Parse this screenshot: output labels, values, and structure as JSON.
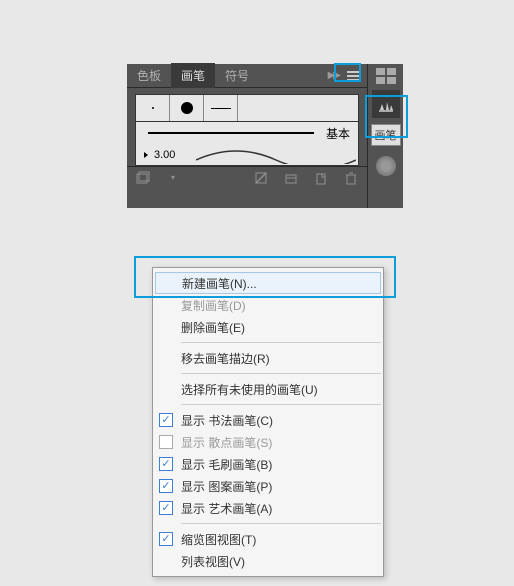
{
  "panel": {
    "tabs": [
      {
        "label": "色板",
        "active": false
      },
      {
        "label": "画笔",
        "active": true
      },
      {
        "label": "符号",
        "active": false
      }
    ],
    "basic_label": "基本",
    "stroke_value": "3.00",
    "side_label": "画笔"
  },
  "context_menu": {
    "items": [
      {
        "label": "新建画笔(N)...",
        "type": "normal",
        "highlighted": true
      },
      {
        "label": "复制画笔(D)",
        "type": "disabled"
      },
      {
        "label": "删除画笔(E)",
        "type": "normal"
      },
      {
        "type": "separator"
      },
      {
        "label": "移去画笔描边(R)",
        "type": "normal"
      },
      {
        "type": "separator"
      },
      {
        "label": "选择所有未使用的画笔(U)",
        "type": "normal"
      },
      {
        "type": "separator"
      },
      {
        "label": "显示 书法画笔(C)",
        "type": "check",
        "checked": true
      },
      {
        "label": "显示 散点画笔(S)",
        "type": "check-disabled",
        "checked": false
      },
      {
        "label": "显示 毛刷画笔(B)",
        "type": "check",
        "checked": true
      },
      {
        "label": "显示 图案画笔(P)",
        "type": "check",
        "checked": true
      },
      {
        "label": "显示 艺术画笔(A)",
        "type": "check",
        "checked": true
      },
      {
        "type": "separator"
      },
      {
        "label": "缩览图视图(T)",
        "type": "check",
        "checked": true
      },
      {
        "label": "列表视图(V)",
        "type": "normal"
      }
    ]
  }
}
